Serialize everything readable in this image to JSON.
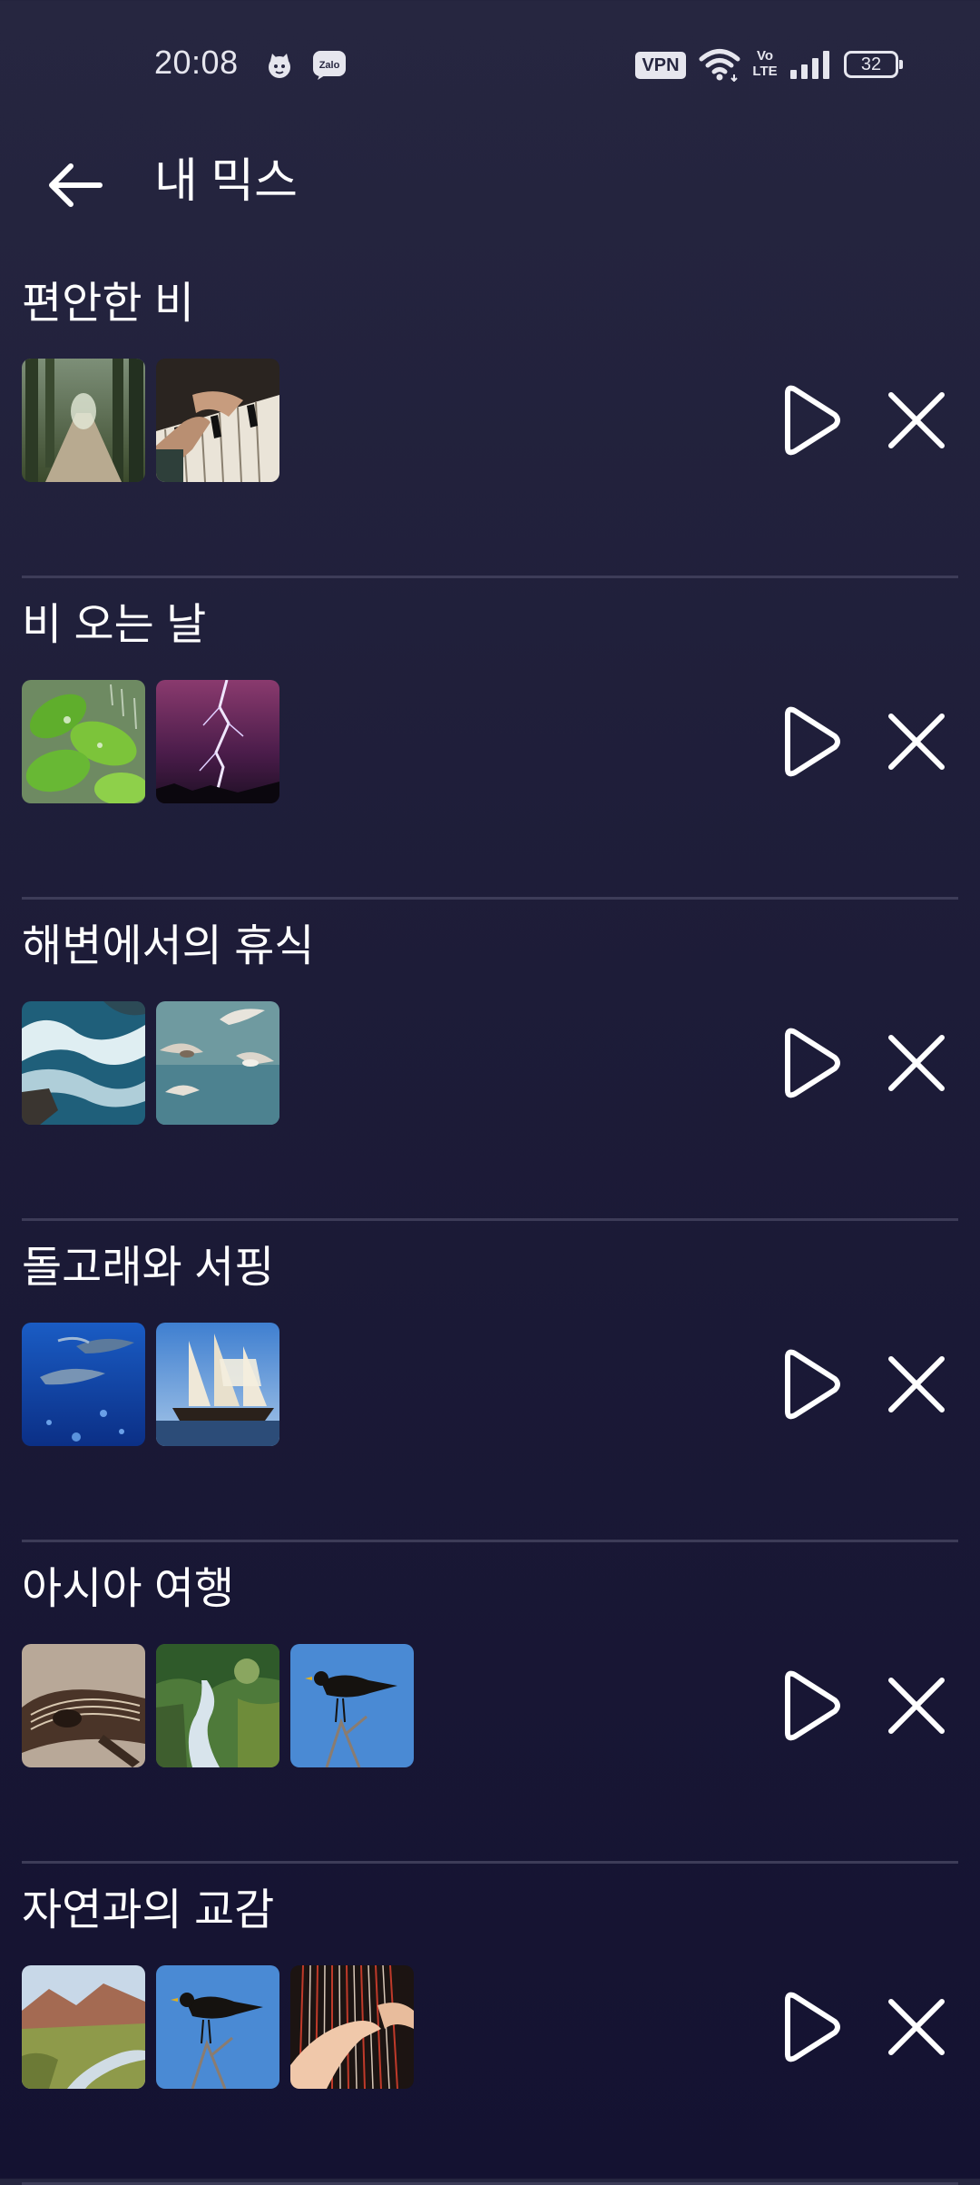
{
  "status_bar": {
    "time": "20:08",
    "vpn_label": "VPN",
    "volte_label": "Vo LTE",
    "battery_level": "32",
    "icons": [
      "cat-notification-icon",
      "zalo-icon",
      "wifi-icon",
      "signal-icon",
      "battery-icon"
    ]
  },
  "header": {
    "title": "내 믹스",
    "back_icon": "arrow-left-icon"
  },
  "mixes": [
    {
      "title": "편안한 비",
      "thumbnails": [
        "forest-path",
        "piano-hands"
      ]
    },
    {
      "title": "비 오는 날",
      "thumbnails": [
        "rain-leaves",
        "lightning"
      ]
    },
    {
      "title": "해변에서의 휴식",
      "thumbnails": [
        "ocean-waves",
        "seagulls"
      ]
    },
    {
      "title": "돌고래와 서핑",
      "thumbnails": [
        "dolphins",
        "sailing-ship"
      ]
    },
    {
      "title": "아시아 여행",
      "thumbnails": [
        "zither",
        "mountain-stream",
        "blackbird"
      ]
    },
    {
      "title": "자연과의 교감",
      "thumbnails": [
        "river-valley",
        "blackbird",
        "harp-hands"
      ]
    }
  ],
  "colors": {
    "background_top": "#262640",
    "background_bottom": "#141231",
    "divider": "#3d3c58",
    "text": "#ffffff"
  }
}
